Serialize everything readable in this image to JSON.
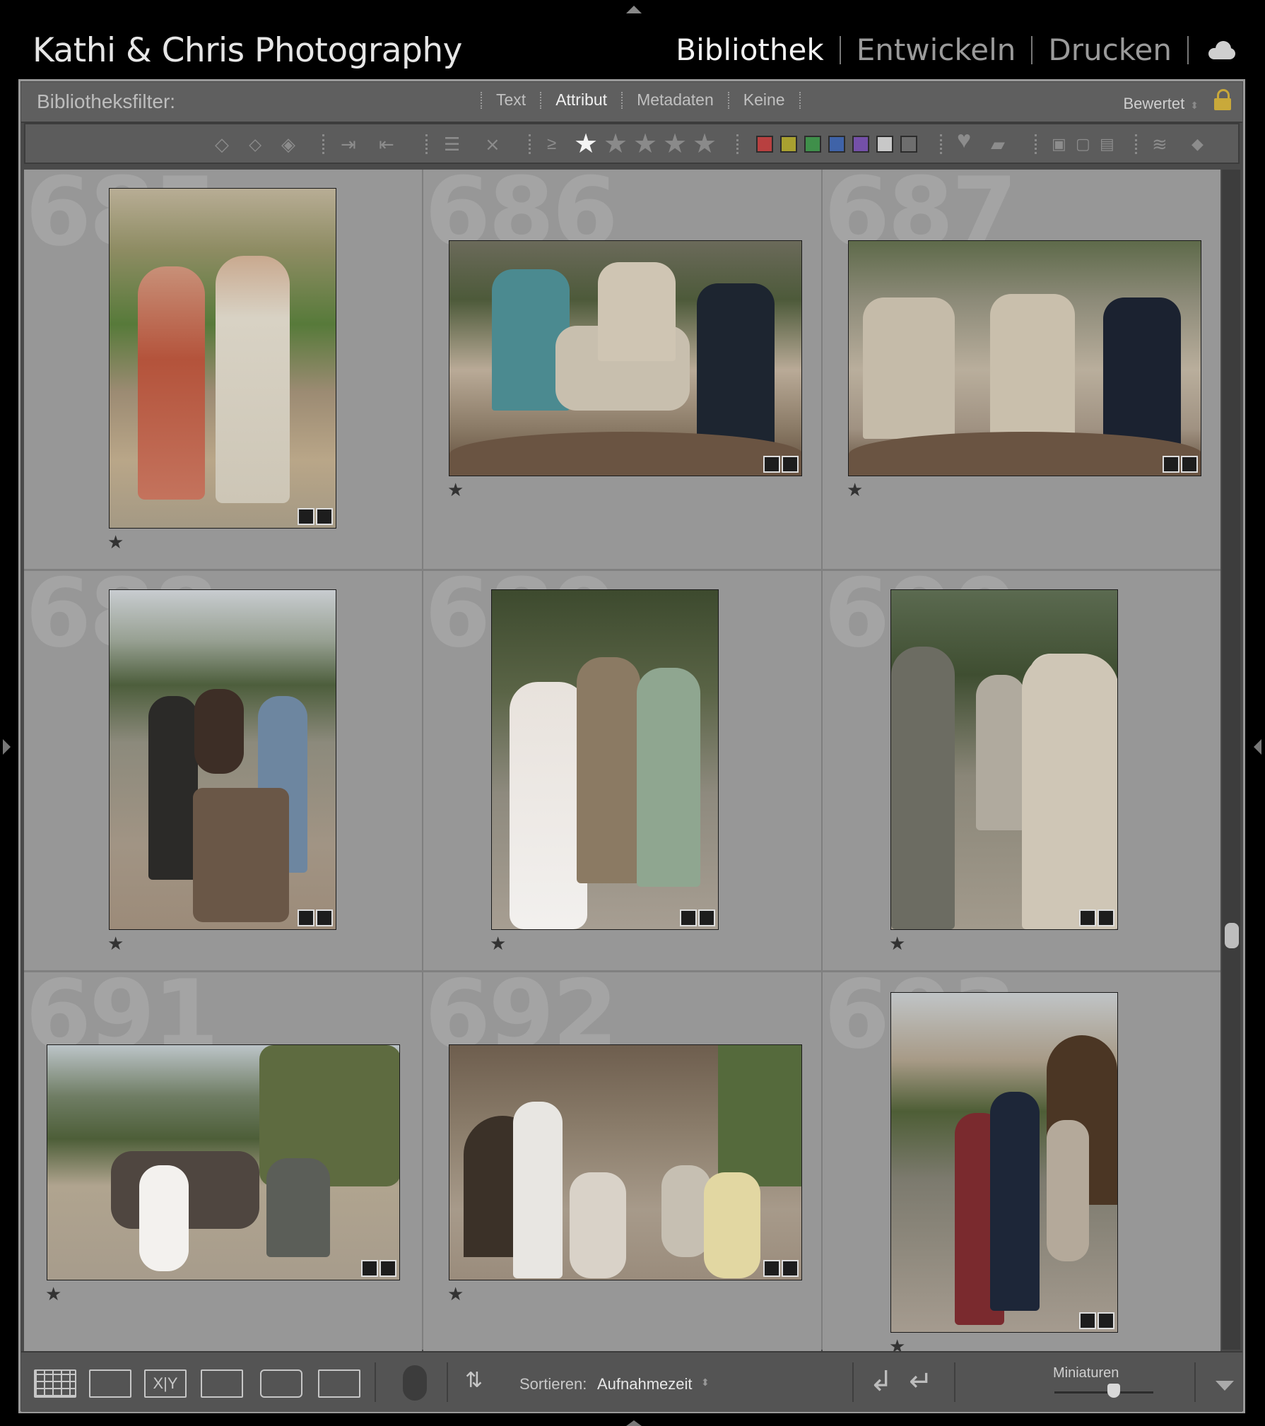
{
  "identity_plate": "Kathi & Chris Photography",
  "modules": [
    {
      "label": "Bibliothek",
      "active": true
    },
    {
      "label": "Entwickeln",
      "active": false
    },
    {
      "label": "Drucken",
      "active": false
    }
  ],
  "filter_bar": {
    "title": "Bibliotheksfilter:",
    "tabs": [
      {
        "label": "Text",
        "active": false
      },
      {
        "label": "Attribut",
        "active": true
      },
      {
        "label": "Metadaten",
        "active": false
      },
      {
        "label": "Keine",
        "active": false
      }
    ],
    "preset": "Bewertet",
    "lock_icon": "padlock-icon"
  },
  "attribute_bar": {
    "rating_operator": "≥",
    "rating_min": 1,
    "rating_max": 5,
    "color_labels": [
      "#b84040",
      "#a8a030",
      "#3f8f4a",
      "#3f63a8",
      "#7450a8",
      "#c8c8c8",
      "#6e6e6e"
    ]
  },
  "grid": {
    "cells": [
      {
        "number": "685",
        "rating": "★"
      },
      {
        "number": "686",
        "rating": "★"
      },
      {
        "number": "687",
        "rating": "★"
      },
      {
        "number": "688",
        "rating": "★"
      },
      {
        "number": "689",
        "rating": "★"
      },
      {
        "number": "690",
        "rating": "★"
      },
      {
        "number": "691",
        "rating": "★"
      },
      {
        "number": "692",
        "rating": "★"
      },
      {
        "number": "693",
        "rating": "★"
      }
    ]
  },
  "toolbar": {
    "sort_label": "Sortieren:",
    "sort_value": "Aufnahmezeit",
    "thumbnail_label": "Miniaturen",
    "thumbnail_size": 0.6
  },
  "colors": {
    "grid_bg": "#979797",
    "active_text": "#f2f2f2",
    "inactive_text": "#9a9a9a"
  }
}
